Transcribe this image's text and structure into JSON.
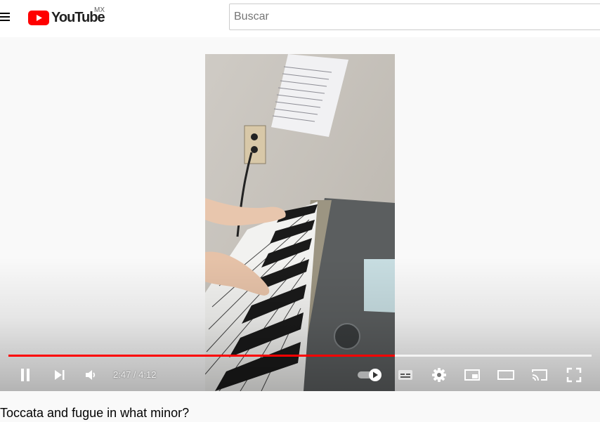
{
  "masthead": {
    "logo_text": "YouTube",
    "country_code": "MX",
    "search_placeholder": "Buscar"
  },
  "player": {
    "current_time": "2:47",
    "separator": " / ",
    "duration": "4:12",
    "played_fraction": 0.663,
    "buffered_fraction": 1.0,
    "autoplay": "on",
    "accent_color": "#ff0000",
    "icons": [
      "pause-icon",
      "next-icon",
      "volume-icon",
      "autoplay-toggle",
      "subtitles-icon",
      "settings-gear-icon",
      "miniplayer-icon",
      "theater-mode-icon",
      "cast-icon",
      "fullscreen-icon"
    ]
  },
  "video": {
    "title": "Toccata and fugue in what minor?"
  }
}
